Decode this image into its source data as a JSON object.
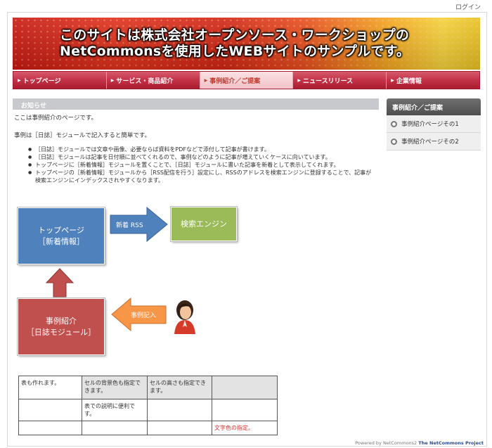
{
  "header": {
    "login": "ログイン",
    "banner_line1": "このサイトは株式会社オープンソース・ワークショップの",
    "banner_line2": "NetCommonsを使用したWEBサイトのサンプルです。"
  },
  "nav": {
    "items": [
      {
        "label": "トップページ"
      },
      {
        "label": "サービス・商品紹介"
      },
      {
        "label": "事例紹介／ご提案"
      },
      {
        "label": "ニュースリリース"
      },
      {
        "label": "企業情報"
      }
    ],
    "active_index": 2
  },
  "main": {
    "box_title": "お知らせ",
    "intro": "ここは事例紹介のページです。",
    "lead": "事例は［日誌］モジュールで記入すると簡単です。",
    "bullets": [
      "［日誌］モジュールでは文章や画像、必要ならば資料をPDFなどで添付して記事が書けます。",
      "［日誌］モジュールは記事を日付順に並べてくれるので、事例などのように記事が増えていくケースに向いています。",
      "トップページに［新着情報］モジュールを置くことで、［日誌］モジュールに書いた記事を新着として表示してくれます。",
      "トップページの［新着情報］モジュールから［RSS配信を行う］設定にし、RSSのアドレスを検索エンジンに登録することで、記事が検索エンジンにインデックスされやすくなります。"
    ]
  },
  "diagram": {
    "top_box_line1": "トップページ",
    "top_box_line2": "［新着情報］",
    "search_box": "検索エンジン",
    "rss_label": "新着 RSS",
    "case_box_line1": "事例紹介",
    "case_box_line2": "［日誌モジュール］",
    "entry_label": "事例記入",
    "colors": {
      "blue": "#4f81bd",
      "green": "#9bbb59",
      "red": "#c0504d",
      "orange": "#f79646"
    }
  },
  "table": {
    "rows": [
      [
        "表も作れます。",
        "セルの背景色も指定できます。",
        "セルの高さも指定できます。",
        ""
      ],
      [
        "",
        "表での説明に便利です。",
        "",
        ""
      ],
      [
        "",
        "",
        "",
        "文字色の指定。"
      ]
    ]
  },
  "sidebar": {
    "title": "事例紹介／ご提案",
    "items": [
      {
        "label": "事例紹介ページその1"
      },
      {
        "label": "事例紹介ページその2"
      }
    ]
  },
  "footer": {
    "powered_prefix": "Powered by NetCommons2",
    "powered_project": "The NetCommons Project"
  }
}
